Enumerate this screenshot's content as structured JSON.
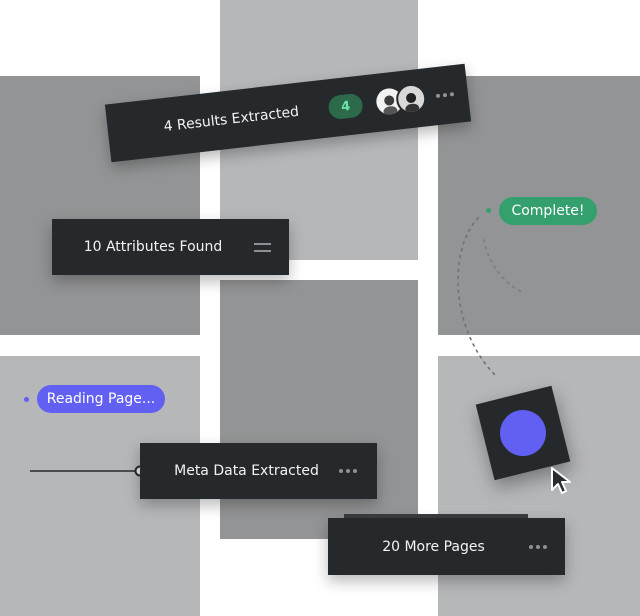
{
  "cards": {
    "results": {
      "label": "4 Results Extracted",
      "badge": "4"
    },
    "attributes": {
      "label": "10 Attributes Found"
    },
    "meta": {
      "label": "Meta Data Extracted"
    },
    "pages": {
      "label": "20 More Pages"
    }
  },
  "pills": {
    "complete": "Complete!",
    "reading": "Reading Page..."
  },
  "colors": {
    "panel_dark": "#939495",
    "panel_light": "#b6b7b9",
    "card": "#26292c",
    "green": "#34a06e",
    "purple": "#6160f2"
  }
}
